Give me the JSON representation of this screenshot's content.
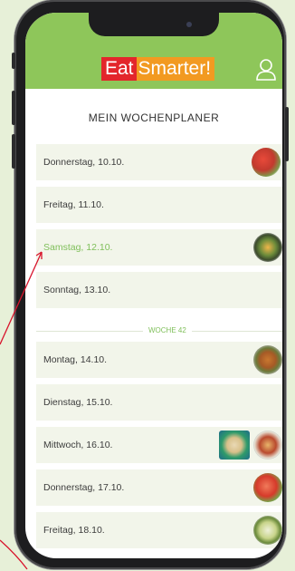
{
  "app": {
    "logo_part1": "Eat",
    "logo_part2": "Smarter",
    "logo_part3": "!"
  },
  "page_title": "MEIN WOCHENPLANER",
  "week_divider": "WOCHE 42",
  "days": [
    {
      "label": "Donnerstag, 10.10.",
      "active": false
    },
    {
      "label": "Freitag, 11.10.",
      "active": false
    },
    {
      "label": "Samstag, 12.10.",
      "active": true
    },
    {
      "label": "Sonntag, 13.10.",
      "active": false
    },
    {
      "label": "Montag, 14.10.",
      "active": false
    },
    {
      "label": "Dienstag, 15.10.",
      "active": false
    },
    {
      "label": "Mittwoch, 16.10.",
      "active": false
    },
    {
      "label": "Donnerstag, 17.10.",
      "active": false
    },
    {
      "label": "Freitag, 18.10.",
      "active": false
    }
  ],
  "colors": {
    "header_green": "#8ec65a",
    "eat_red": "#e3262b",
    "smarter_orange": "#f29a21",
    "active_day": "#7fbf5a",
    "annotation_arrow": "#d8142c"
  },
  "icons": [
    "user-icon",
    "food-thumbnail"
  ]
}
